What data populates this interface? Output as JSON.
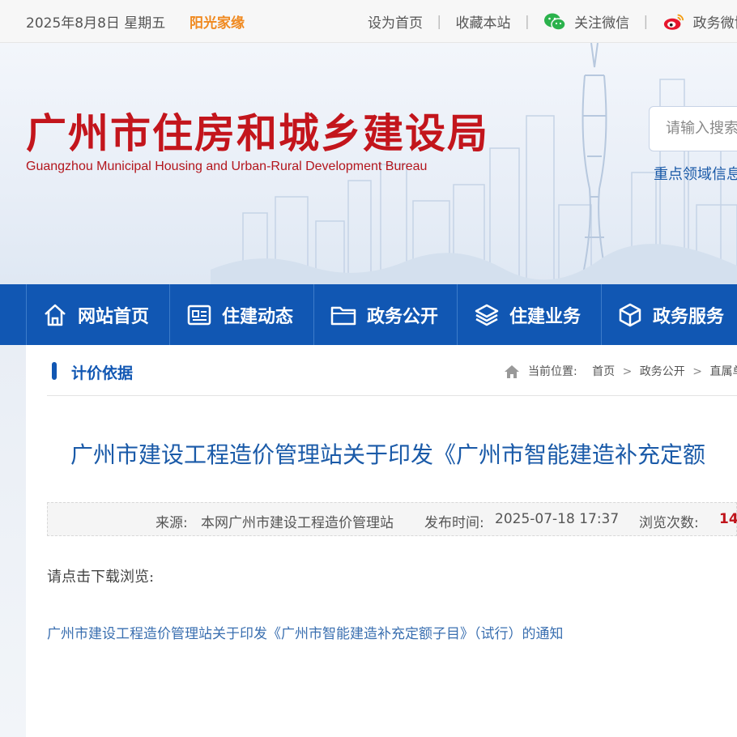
{
  "topbar": {
    "date": "2025年8月8日 星期五",
    "sunshine": "阳光家缘",
    "set_home": "设为首页",
    "bookmark": "收藏本站",
    "wechat": "关注微信",
    "weibo": "政务微博"
  },
  "header": {
    "title": "广州市住房和城乡建设局",
    "subtitle": "Guangzhou Municipal Housing and Urban-Rural Development Bureau",
    "search_placeholder": "请输入搜索",
    "key_link": "重点领域信息"
  },
  "nav": {
    "items": [
      {
        "label": "网站首页",
        "icon": "home-icon"
      },
      {
        "label": "住建动态",
        "icon": "news-icon"
      },
      {
        "label": "政务公开",
        "icon": "folder-icon"
      },
      {
        "label": "住建业务",
        "icon": "layers-icon"
      },
      {
        "label": "政务服务",
        "icon": "cube-icon"
      }
    ]
  },
  "section": {
    "title": "计价依据"
  },
  "breadcrumb": {
    "prefix": "当前位置:",
    "items": [
      "首页",
      "政务公开",
      "直属单"
    ]
  },
  "article": {
    "title": "广州市建设工程造价管理站关于印发《广州市智能建造补充定额",
    "source_label": "来源:",
    "source_value": "本网广州市建设工程造价管理站",
    "time_label": "发布时间:",
    "time_value": "2025-07-18 17:37",
    "views_label": "浏览次数:",
    "views_value": "14",
    "prompt": "请点击下载浏览:",
    "attachment": "广州市建设工程造价管理站关于印发《广州市智能建造补充定额子目》（试行）的通知"
  },
  "colors": {
    "nav_bg": "#1157b3",
    "title_red": "#c3151c",
    "link_blue": "#1a5aa8",
    "accent_orange": "#f0891f"
  }
}
